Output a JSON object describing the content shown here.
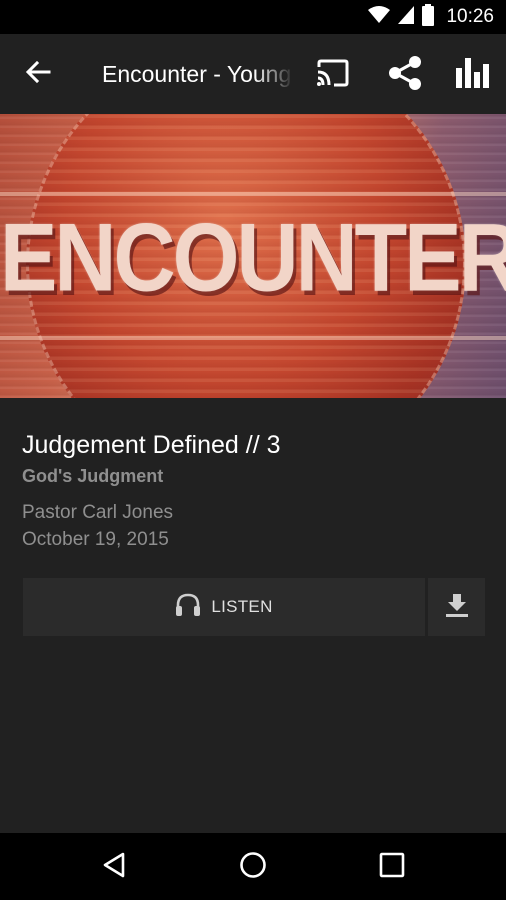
{
  "status_bar": {
    "time": "10:26",
    "icons": [
      "wifi-icon",
      "signal-icon",
      "battery-icon"
    ]
  },
  "app_bar": {
    "title": "Encounter - Young",
    "icons": [
      "back-arrow-icon",
      "cast-icon",
      "share-icon",
      "stats-icon"
    ]
  },
  "hero": {
    "artwork_text": "ENCOUNTER"
  },
  "sermon": {
    "title": "Judgement Defined // 3",
    "series": "God's Judgment",
    "speaker": "Pastor Carl Jones",
    "date": "October 19, 2015"
  },
  "actions": {
    "listen_label": "LISTEN",
    "listen_icon": "headphones-icon",
    "download_icon": "download-icon"
  },
  "nav_bar": {
    "icons": [
      "nav-back-icon",
      "nav-home-icon",
      "nav-recents-icon"
    ]
  },
  "colors": {
    "background": "#212121",
    "status_bar": "#000000",
    "secondary_text": "#8f8f8f",
    "button_bg": "#2b2b2b"
  }
}
